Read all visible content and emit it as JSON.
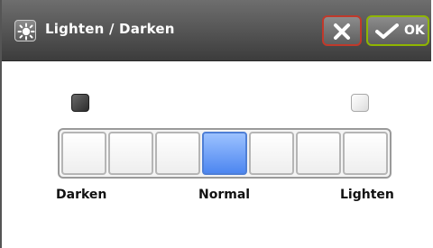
{
  "dialog": {
    "title": "Lighten / Darken",
    "title_icon": "brightness-icon",
    "cancel_icon": "close-icon",
    "ok_label": "OK",
    "ok_icon": "checkmark-icon"
  },
  "control": {
    "left_indicator": "dark-swatch-icon",
    "right_indicator": "light-swatch-icon",
    "steps_total": 7,
    "selected_step_index": 3,
    "labels": {
      "darken": "Darken",
      "normal": "Normal",
      "lighten": "Lighten"
    },
    "colors": {
      "active": "#6FA2FF",
      "cancel_border": "#C0392B",
      "ok_border": "#8FB500"
    }
  }
}
